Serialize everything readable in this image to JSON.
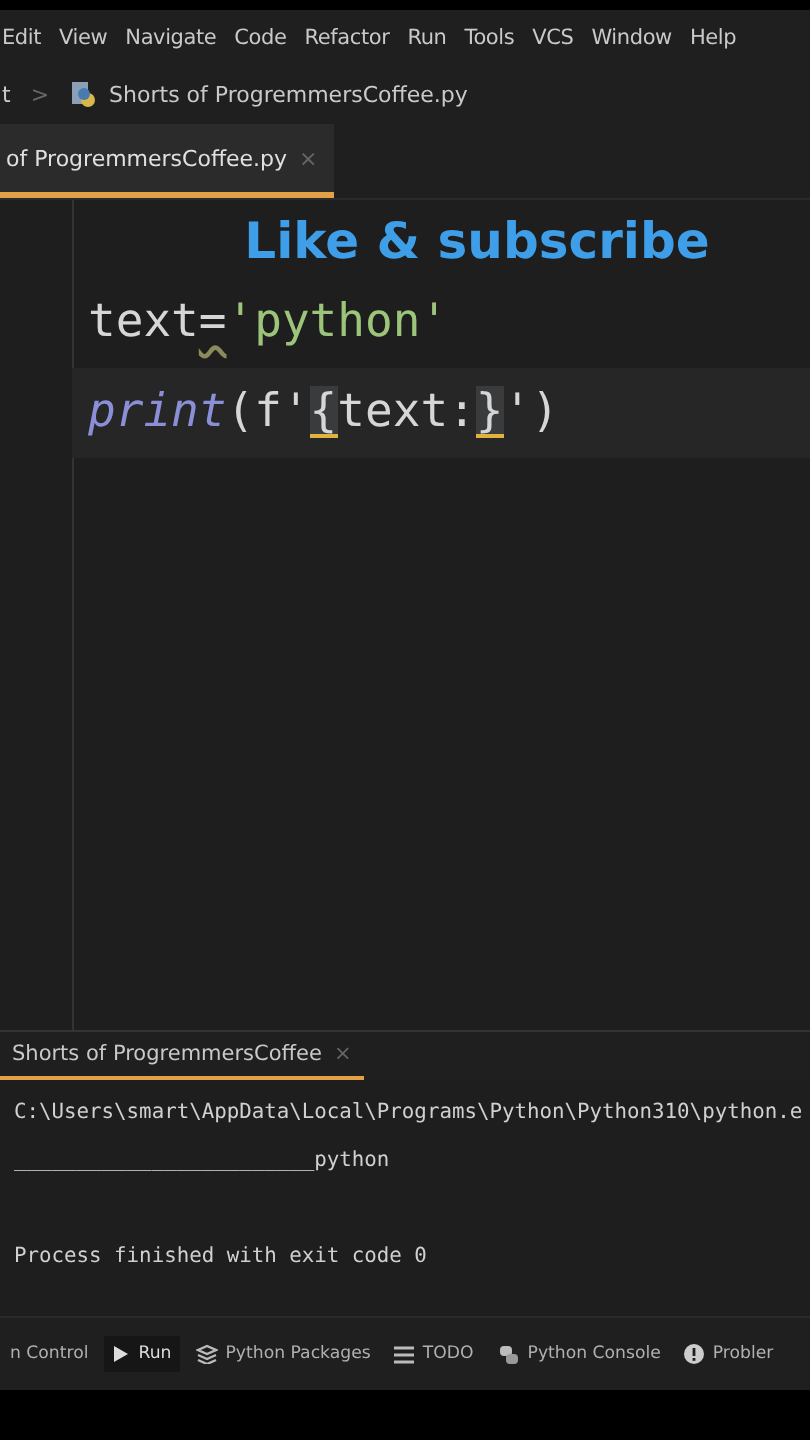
{
  "menu": [
    {
      "label": "Edit"
    },
    {
      "label": "View"
    },
    {
      "label": "Navigate"
    },
    {
      "label": "Code"
    },
    {
      "label": "Refactor"
    },
    {
      "label": "Run"
    },
    {
      "label": "Tools"
    },
    {
      "label": "VCS"
    },
    {
      "label": "Window"
    },
    {
      "label": "Help"
    }
  ],
  "breadcrumb": {
    "project": "t",
    "separator": ">",
    "file": "Shorts of ProgremmersCoffee.py"
  },
  "editor_tabs": [
    {
      "label": "of ProgremmersCoffee.py",
      "close": "×",
      "selected": true
    }
  ],
  "overlay": "Like & subscribe",
  "code_lines": [
    {
      "current": false,
      "tokens": [
        {
          "text": "text",
          "kind": "plain"
        },
        {
          "text": "=",
          "kind": "warn"
        },
        {
          "text": "'python'",
          "kind": "string"
        }
      ]
    },
    {
      "current": true,
      "tokens": [
        {
          "text": "print",
          "kind": "builtin"
        },
        {
          "text": "(f'",
          "kind": "plain"
        },
        {
          "text": "{",
          "kind": "match"
        },
        {
          "text": "text:",
          "kind": "plain"
        },
        {
          "text": "}",
          "kind": "match"
        },
        {
          "text": "')",
          "kind": "plain"
        }
      ]
    }
  ],
  "run_tab": {
    "label": "Shorts of ProgremmersCoffee",
    "close": "×",
    "selected": true
  },
  "console": [
    "C:\\Users\\smart\\AppData\\Local\\Programs\\Python\\Python310\\python.e",
    "________________________python",
    "Process finished with exit code 0"
  ],
  "bottom_tools": [
    {
      "label": "n Control",
      "kind": "none",
      "selected": false
    },
    {
      "label": "Run",
      "kind": "play",
      "selected": true
    },
    {
      "label": "Python Packages",
      "kind": "layers",
      "selected": false
    },
    {
      "label": "TODO",
      "kind": "list",
      "selected": false
    },
    {
      "label": "Python Console",
      "kind": "python",
      "selected": false
    },
    {
      "label": "Probler",
      "kind": "alert",
      "selected": false
    }
  ]
}
